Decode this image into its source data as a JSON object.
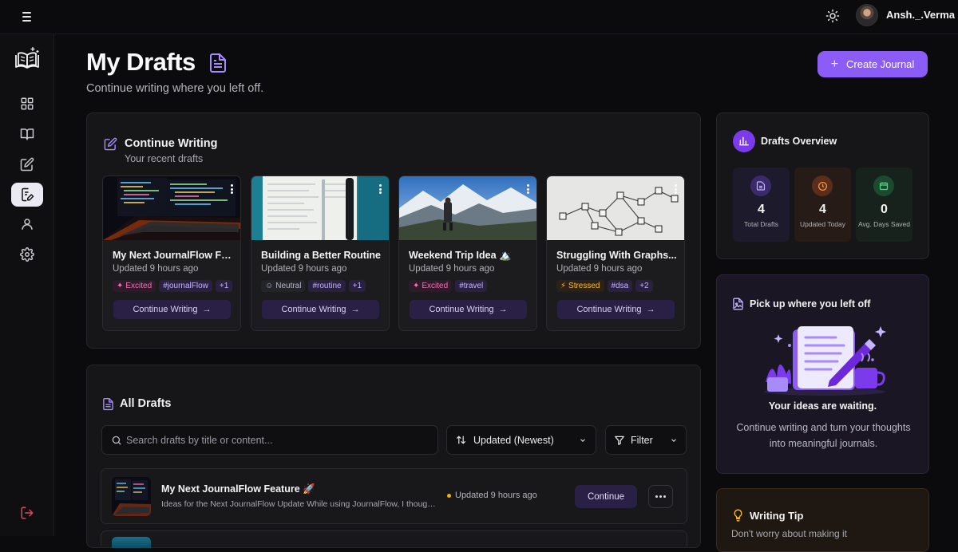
{
  "user": {
    "name": "Ansh._.Verma"
  },
  "page": {
    "title": "My Drafts",
    "subtitle": "Continue writing where you left off.",
    "create_label": "Create Journal"
  },
  "continue_writing": {
    "title": "Continue Writing",
    "subtitle": "Your recent drafts",
    "button_label": "Continue Writing",
    "cards": [
      {
        "title": "My Next JournalFlow Feature 🚀",
        "updated": "Updated 9 hours ago",
        "mood": "Excited",
        "tag": "#journalFlow",
        "more": "+1"
      },
      {
        "title": "Building a Better Routine",
        "updated": "Updated 9 hours ago",
        "mood": "Neutral",
        "tag": "#routine",
        "more": "+1"
      },
      {
        "title": "Weekend Trip Idea 🏔️",
        "updated": "Updated 9 hours ago",
        "mood": "Excited",
        "tag": "#travel",
        "more": ""
      },
      {
        "title": "Struggling With Graphs...",
        "updated": "Updated 9 hours ago",
        "mood": "Stressed",
        "tag": "#dsa",
        "more": "+2"
      }
    ]
  },
  "all_drafts": {
    "title": "All Drafts",
    "search_placeholder": "Search drafts by title or content...",
    "sort_label": "Updated (Newest)",
    "filter_label": "Filter",
    "rows": [
      {
        "title": "My Next JournalFlow Feature 🚀",
        "desc": "Ideas for the Next JournalFlow Update While using JournalFlow, I thought about a few features",
        "updated": "Updated 9 hours ago",
        "button": "Continue"
      }
    ]
  },
  "overview": {
    "title": "Drafts Overview",
    "stats": [
      {
        "value": "4",
        "label": "Total Drafts"
      },
      {
        "value": "4",
        "label": "Updated Today"
      },
      {
        "value": "0",
        "label": "Avg. Days Saved"
      }
    ]
  },
  "pickup": {
    "title": "Pick up where you left off",
    "heading": "Your ideas are waiting.",
    "text": "Continue writing and turn your thoughts into meaningful journals."
  },
  "tip": {
    "title": "Writing Tip",
    "text": "Don't worry about making it"
  },
  "colors": {
    "accent": "#8b5cf6",
    "background": "#0b0b0d",
    "panel": "#161618"
  }
}
